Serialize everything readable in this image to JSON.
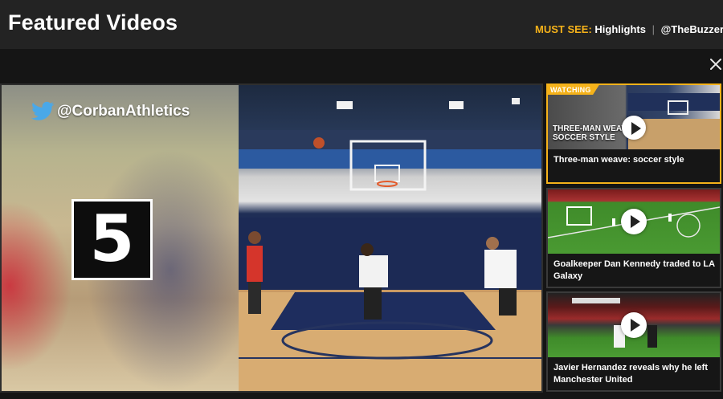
{
  "header": {
    "title": "Featured Videos",
    "must_see": {
      "label": "MUST SEE:",
      "links": [
        "Highlights",
        "@TheBuzzer"
      ],
      "separator": "|"
    }
  },
  "player": {
    "twitter_handle": "@CorbanAthletics",
    "countdown_number": "5",
    "icons": {
      "close": "close-icon",
      "twitter": "twitter-bird-icon"
    }
  },
  "playlist": [
    {
      "title": "Three-man weave: soccer style",
      "badge": "WATCHING",
      "thumb_caption_line1": "THREE-MAN WEAVE",
      "thumb_caption_line2": "SOCCER STYLE",
      "active": true
    },
    {
      "title": "Goalkeeper Dan Kennedy traded to LA Galaxy",
      "active": false
    },
    {
      "title": "Javier Hernandez reveals why he left Manchester United",
      "active": false
    }
  ],
  "colors": {
    "accent": "#f5b21a",
    "header_bg": "#232323",
    "page_bg": "#151515"
  }
}
